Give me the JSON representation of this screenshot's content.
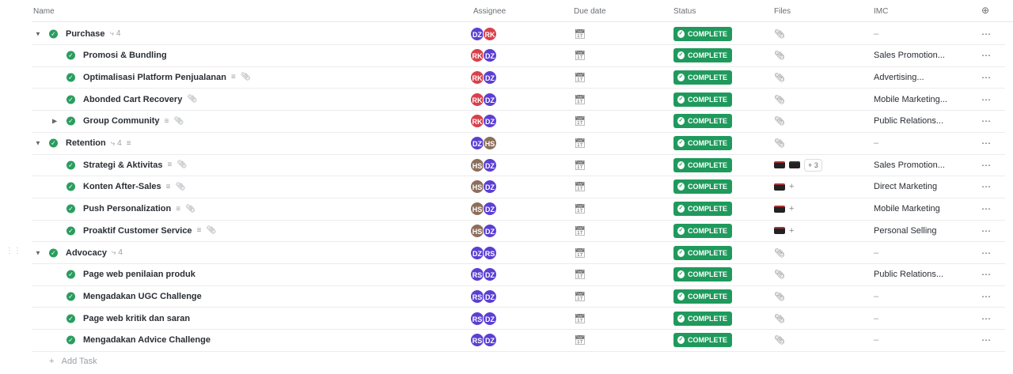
{
  "header": {
    "name": "Name",
    "assignee": "Assignee",
    "due": "Due date",
    "status": "Status",
    "files": "Files",
    "imc": "IMC",
    "add_column_icon": "plus-circle-icon"
  },
  "colors": {
    "complete": "#1f9a5c",
    "DZ": "#5b3fd3",
    "RK": "#d9404a",
    "HS": "#8c6e5c",
    "RS": "#5b3fd3"
  },
  "rows": [
    {
      "level": 0,
      "caret": "down",
      "name": "Purchase",
      "subtasks": "4",
      "desc": false,
      "attach": false,
      "assignees": [
        "DZ",
        "RK"
      ],
      "status": "COMPLETE",
      "files": "clip",
      "imc": "–"
    },
    {
      "level": 1,
      "name": "Promosi & Bundling",
      "desc": false,
      "attach": false,
      "assignees": [
        "RK",
        "DZ"
      ],
      "status": "COMPLETE",
      "files": "clip",
      "imc": "Sales Promotion..."
    },
    {
      "level": 1,
      "name": "Optimalisasi Platform Penjualanan",
      "desc": true,
      "attach": true,
      "assignees": [
        "RK",
        "DZ"
      ],
      "status": "COMPLETE",
      "files": "clip",
      "imc": "Advertising..."
    },
    {
      "level": 1,
      "name": "Abonded Cart Recovery",
      "desc": false,
      "attach": true,
      "assignees": [
        "RK",
        "DZ"
      ],
      "status": "COMPLETE",
      "files": "clip",
      "imc": "Mobile Marketing..."
    },
    {
      "level": 1,
      "caret": "right",
      "name": "Group Community",
      "desc": true,
      "attach": true,
      "assignees": [
        "RK",
        "DZ"
      ],
      "status": "COMPLETE",
      "files": "clip",
      "imc": "Public Relations..."
    },
    {
      "level": 0,
      "caret": "down",
      "name": "Retention",
      "subtasks": "4",
      "desc": true,
      "attach": false,
      "assignees": [
        "DZ",
        "HS"
      ],
      "status": "COMPLETE",
      "files": "clip",
      "imc": "–"
    },
    {
      "level": 1,
      "name": "Strategi & Aktivitas",
      "desc": true,
      "attach": true,
      "assignees": [
        "HS",
        "DZ"
      ],
      "status": "COMPLETE",
      "files": "thumbs2",
      "more": "+ 3",
      "imc": "Sales Promotion..."
    },
    {
      "level": 1,
      "name": "Konten After-Sales",
      "desc": true,
      "attach": true,
      "assignees": [
        "HS",
        "DZ"
      ],
      "status": "COMPLETE",
      "files": "thumb1",
      "imc": "Direct Marketing"
    },
    {
      "level": 1,
      "name": "Push Personalization",
      "desc": true,
      "attach": true,
      "assignees": [
        "HS",
        "DZ"
      ],
      "status": "COMPLETE",
      "files": "thumb1",
      "imc": "Mobile Marketing"
    },
    {
      "level": 1,
      "name": "Proaktif Customer Service",
      "desc": true,
      "attach": true,
      "assignees": [
        "HS",
        "DZ"
      ],
      "status": "COMPLETE",
      "files": "thumb1",
      "imc": "Personal Selling"
    },
    {
      "level": 0,
      "caret": "down",
      "name": "Advocacy",
      "subtasks": "4",
      "desc": false,
      "attach": false,
      "assignees": [
        "DZ",
        "RS"
      ],
      "status": "COMPLETE",
      "files": "clip",
      "imc": "–"
    },
    {
      "level": 1,
      "name": "Page web penilaian produk",
      "desc": false,
      "attach": false,
      "assignees": [
        "RS",
        "DZ"
      ],
      "status": "COMPLETE",
      "files": "clip",
      "imc": "Public Relations..."
    },
    {
      "level": 1,
      "name": "Mengadakan UGC Challenge",
      "desc": false,
      "attach": false,
      "assignees": [
        "RS",
        "DZ"
      ],
      "status": "COMPLETE",
      "files": "clip",
      "imc": "–"
    },
    {
      "level": 1,
      "name": "Page web kritik dan saran",
      "desc": false,
      "attach": false,
      "assignees": [
        "RS",
        "DZ"
      ],
      "status": "COMPLETE",
      "files": "clip",
      "imc": "–"
    },
    {
      "level": 1,
      "name": "Mengadakan Advice Challenge",
      "desc": false,
      "attach": false,
      "assignees": [
        "RS",
        "DZ"
      ],
      "status": "COMPLETE",
      "files": "clip",
      "imc": "–"
    }
  ],
  "add_task": "Add Task"
}
